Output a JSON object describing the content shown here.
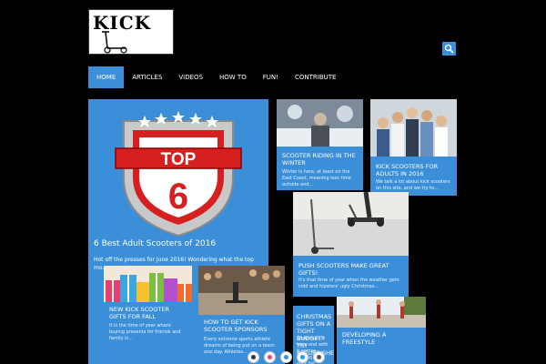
{
  "logo": {
    "text": "KICK"
  },
  "header": {
    "search_icon": "search-icon"
  },
  "nav": {
    "items": [
      {
        "label": "HOME",
        "active": true
      },
      {
        "label": "ARTICLES"
      },
      {
        "label": "VIDEOS"
      },
      {
        "label": "HOW TO"
      },
      {
        "label": "FUN!"
      },
      {
        "label": "CONTRIBUTE"
      }
    ]
  },
  "featured": {
    "badge_text": "TOP",
    "badge_number": "6",
    "title": "6 Best Adult Scooters of 2016",
    "excerpt": "Hot off the presses for June 2016! Wondering what the top mo..."
  },
  "posts": [
    {
      "title": "SCOOTER RIDING IN THE WINTER",
      "excerpt": "Winter is here, at least on the East Coast, meaning less time outside and..."
    },
    {
      "title": "KICK SCOOTERS FOR ADULTS IN 2016",
      "excerpt": "We talk a lot about kick scooters on this site, and we try to..."
    },
    {
      "title": "PUSH SCOOTERS MAKE GREAT GIFTS!",
      "excerpt": "It's that time of year when the weather gets cold and hipsters' ugly Christmas..."
    },
    {
      "title": "NEW KICK SCOOTER GIFTS FOR FALL",
      "excerpt": "It is the time of year where buying presents for friends and family is..."
    },
    {
      "title": "HOW TO GET KICK SCOOTER SPONSORS",
      "excerpt": "Every extreme sports athlete dreams of being put on a team one day. Athletes..."
    },
    {
      "title": "CHRISTMAS GIFTS ON A TIGHT BUDGET? TRY REFURBISHED",
      "excerpt": "Christmas is here and with it comes buying gifts, your list..."
    },
    {
      "title": "DEVELOPING A FREESTYLE"
    }
  ],
  "colors": {
    "accent": "#3b8fd9",
    "background": "#000000"
  }
}
